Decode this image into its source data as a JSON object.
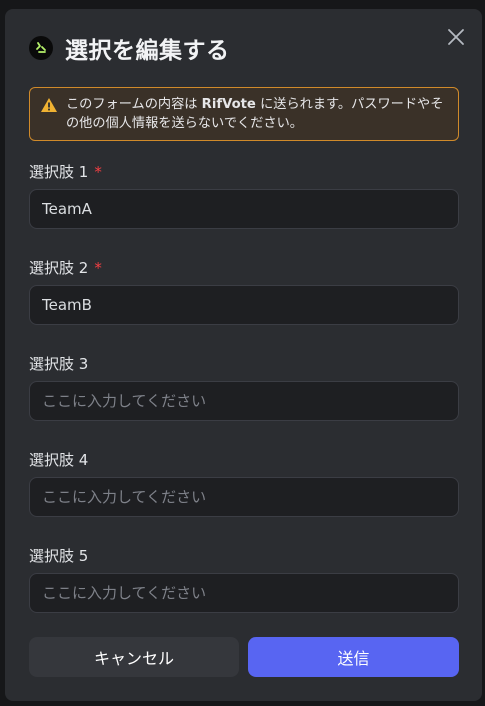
{
  "dialog": {
    "title": "選択を編集する",
    "warning": {
      "prefix": "このフォームの内容は ",
      "brand": "RifVote",
      "suffix": " に送られます。パスワードやその他の個人情報を送らないでください。"
    },
    "fields": [
      {
        "label": "選択肢 1",
        "required": true,
        "value": "TeamA",
        "placeholder": "ここに入力してください"
      },
      {
        "label": "選択肢 2",
        "required": true,
        "value": "TeamB",
        "placeholder": "ここに入力してください"
      },
      {
        "label": "選択肢 3",
        "required": false,
        "value": "",
        "placeholder": "ここに入力してください"
      },
      {
        "label": "選択肢 4",
        "required": false,
        "value": "",
        "placeholder": "ここに入力してください"
      },
      {
        "label": "選択肢 5",
        "required": false,
        "value": "",
        "placeholder": "ここに入力してください"
      }
    ],
    "required_mark": "*",
    "cancel_label": "キャンセル",
    "submit_label": "送信"
  },
  "colors": {
    "accent": "#5865f2",
    "warning_border": "#d08a2a",
    "required": "#f23f43"
  }
}
